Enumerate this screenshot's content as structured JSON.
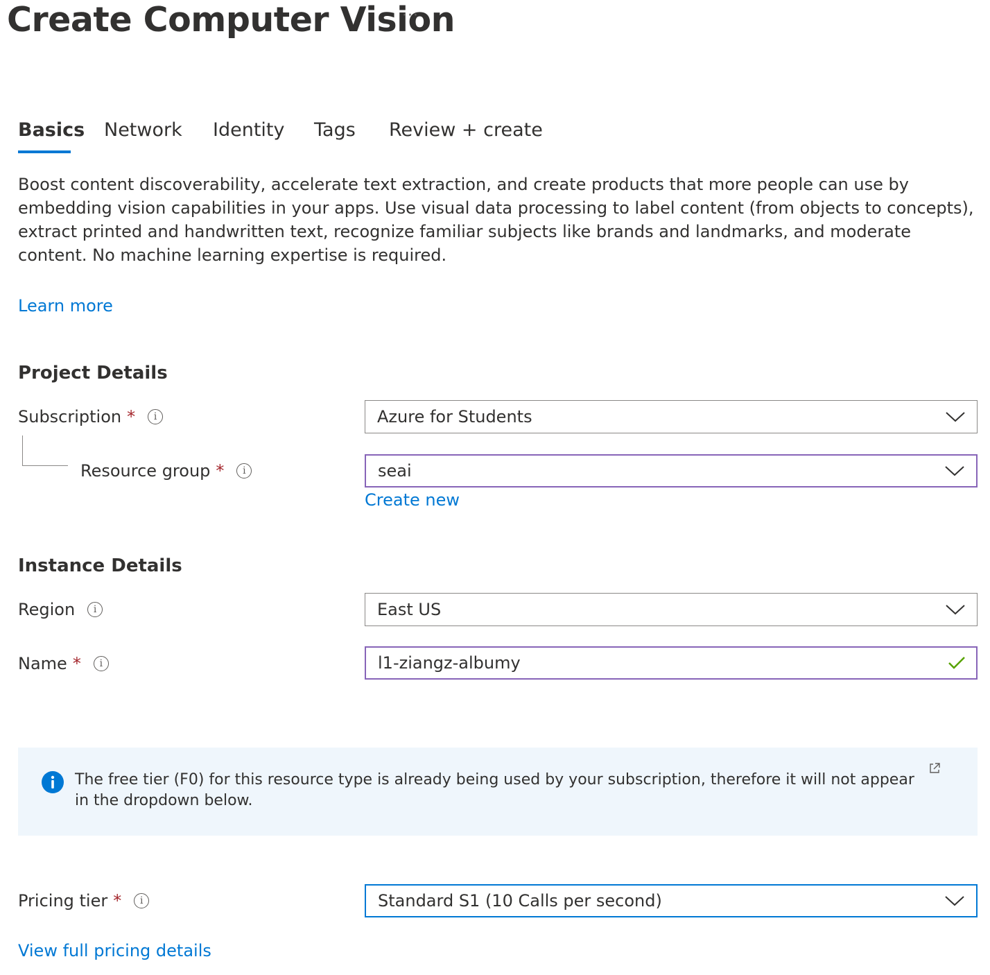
{
  "header": {
    "title": "Create Computer Vision",
    "more_label": "···"
  },
  "tabs": [
    {
      "label": "Basics",
      "active": true
    },
    {
      "label": "Network",
      "active": false
    },
    {
      "label": "Identity",
      "active": false
    },
    {
      "label": "Tags",
      "active": false
    },
    {
      "label": "Review + create",
      "active": false
    }
  ],
  "description": "Boost content discoverability, accelerate text extraction, and create products that more people can use by embedding vision capabilities in your apps. Use visual data processing to label content (from objects to concepts), extract printed and handwritten text, recognize familiar subjects like brands and landmarks, and moderate content. No machine learning expertise is required.",
  "learn_more": "Learn more",
  "project": {
    "heading": "Project Details",
    "subscription": {
      "label": "Subscription",
      "required": "*",
      "value": "Azure for Students"
    },
    "resource_group": {
      "label": "Resource group",
      "required": "*",
      "value": "seai",
      "create_new": "Create new"
    }
  },
  "instance": {
    "heading": "Instance Details",
    "region": {
      "label": "Region",
      "value": "East US"
    },
    "name": {
      "label": "Name",
      "required": "*",
      "value": "l1-ziangz-albumy"
    }
  },
  "banner": {
    "text": "The free tier (F0) for this resource type is already being used by your subscription, therefore it will not appear in the dropdown below."
  },
  "pricing": {
    "label": "Pricing tier",
    "required": "*",
    "value": "Standard S1 (10 Calls per second)",
    "details_link": "View full pricing details"
  },
  "colors": {
    "accent": "#0078d4",
    "required": "#a4262c",
    "valid": "#57a300",
    "focus_purple": "#8764b8",
    "banner_bg": "#eff6fc"
  }
}
